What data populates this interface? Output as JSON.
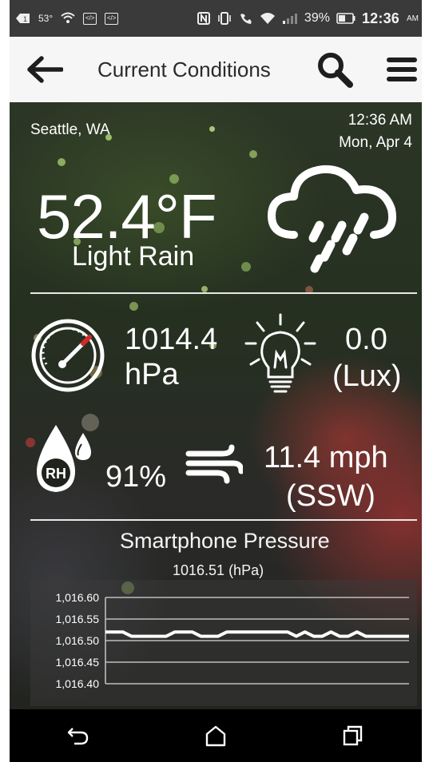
{
  "status_bar": {
    "temp": "53°",
    "battery": "39%",
    "time": "12:36",
    "ampm": "AM"
  },
  "app_bar": {
    "title": "Current Conditions"
  },
  "weather": {
    "location": "Seattle, WA",
    "time": "12:36 AM",
    "date": "Mon, Apr 4",
    "temperature": "52.4°F",
    "condition": "Light Rain",
    "pressure_value": "1014.4",
    "pressure_unit": "hPa",
    "light_value": "0.0",
    "light_unit": "(Lux)",
    "humidity_icon_label": "RH",
    "humidity_value": "91%",
    "wind_value": "11.4 mph",
    "wind_dir": "(SSW)"
  },
  "chart": {
    "title": "Smartphone Pressure",
    "current": "1016.51 (hPa)"
  },
  "chart_data": {
    "type": "line",
    "title": "Smartphone Pressure",
    "subtitle": "1016.51 (hPa)",
    "xlabel": "",
    "ylabel": "",
    "ylim": [
      1016.4,
      1016.6
    ],
    "y_ticks": [
      "1,016.60",
      "1,016.55",
      "1,016.50",
      "1,016.45",
      "1,016.40"
    ],
    "grid": true,
    "series": [
      {
        "values": [
          1016.52,
          1016.52,
          1016.52,
          1016.51,
          1016.51,
          1016.51,
          1016.51,
          1016.51,
          1016.52,
          1016.52,
          1016.52,
          1016.51,
          1016.51,
          1016.51,
          1016.52,
          1016.52,
          1016.52,
          1016.52,
          1016.52,
          1016.52,
          1016.52,
          1016.52,
          1016.51,
          1016.52,
          1016.51,
          1016.51,
          1016.52,
          1016.51,
          1016.51,
          1016.52,
          1016.51,
          1016.51,
          1016.51,
          1016.51,
          1016.51,
          1016.51
        ]
      }
    ]
  },
  "colors": {
    "app_bar_bg": "#f6f6f6",
    "status_bar_bg": "#3a3a3a",
    "nav_bar_bg": "#000000",
    "text_on_image": "#ffffff",
    "gauge_needle_accent": "#d22a2a"
  }
}
